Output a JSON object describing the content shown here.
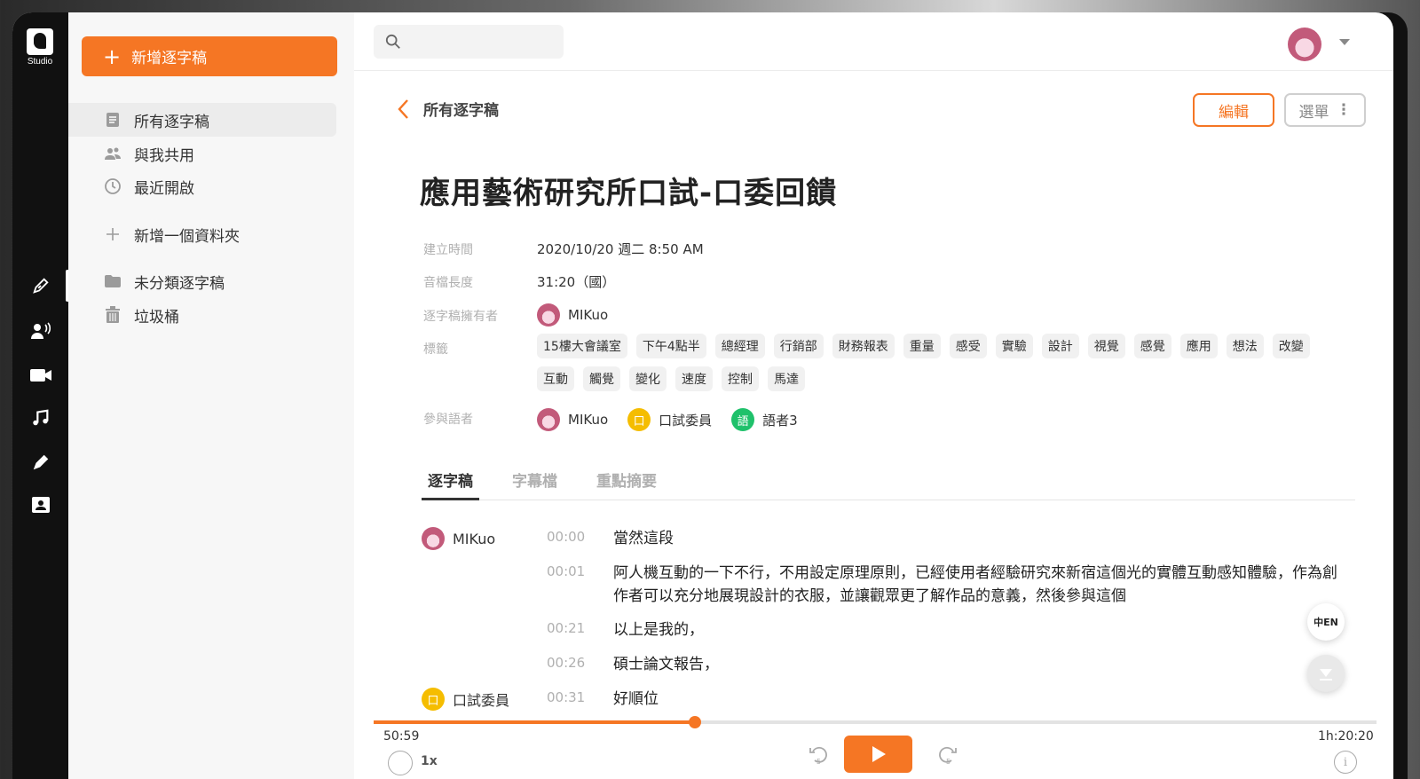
{
  "app": {
    "logo_text": "Studio"
  },
  "sidebar": {
    "new_button": "新增逐字稿",
    "items": [
      {
        "label": "所有逐字稿",
        "icon": "document-icon"
      },
      {
        "label": "與我共用",
        "icon": "people-icon"
      },
      {
        "label": "最近開啟",
        "icon": "clock-icon"
      },
      {
        "label": "新增一個資料夾",
        "icon": "plus-icon"
      },
      {
        "label": "未分類逐字稿",
        "icon": "folder-icon"
      },
      {
        "label": "垃圾桶",
        "icon": "trash-icon"
      }
    ]
  },
  "rail": {
    "items": [
      "pen-icon",
      "speaker-icon",
      "video-icon",
      "music-icon",
      "edit-icon",
      "contact-icon"
    ]
  },
  "search": {
    "placeholder": ""
  },
  "header": {
    "back_label": "所有逐字稿",
    "edit_button": "編輯",
    "menu_button": "選單"
  },
  "transcript": {
    "title": "應用藝術研究所口試-口委回饋",
    "meta": {
      "created_label": "建立時間",
      "created_value": "2020/10/20 週二 8:50 AM",
      "duration_label": "音檔長度",
      "duration_value": "31:20（國）",
      "owner_label": "逐字稿擁有者",
      "owner_value": "MIKuo",
      "tags_label": "標籤",
      "speakers_label": "參與語者"
    },
    "tags": [
      "15樓大會議室",
      "下午4點半",
      "總經理",
      "行銷部",
      "財務報表",
      "重量",
      "感受",
      "實驗",
      "設計",
      "視覺",
      "感覺",
      "應用",
      "想法",
      "改變",
      "互動",
      "觸覺",
      "變化",
      "速度",
      "控制",
      "馬達"
    ],
    "speakers": [
      {
        "name": "MIKuo",
        "badge": "",
        "color": "#c25a7a"
      },
      {
        "name": "口試委員",
        "badge": "口",
        "color": "#f5bd00"
      },
      {
        "name": "語者3",
        "badge": "語",
        "color": "#1fc16b"
      }
    ]
  },
  "tabs": [
    "逐字稿",
    "字幕檔",
    "重點摘要"
  ],
  "lines": [
    {
      "speaker": "MIKuo",
      "time": "00:00",
      "text": "當然這段"
    },
    {
      "speaker": "",
      "time": "00:01",
      "text": "阿人機互動的一下不行，不用設定原理原則，已經使用者經驗研究來新宿這個光的實體互動感知體驗，作為創作者可以充分地展現設計的衣服，並讓觀眾更了解作品的意義，然後參與這個"
    },
    {
      "speaker": "",
      "time": "00:21",
      "text": "以上是我的，"
    },
    {
      "speaker": "",
      "time": "00:26",
      "text": "碩士論文報告，"
    },
    {
      "speaker": "口試委員",
      "time": "00:31",
      "text": "好順位"
    }
  ],
  "float": {
    "translate_label": "中EN"
  },
  "player": {
    "current_time": "50:59",
    "total_time": "1h:20:20",
    "speed": "1x",
    "progress": 0.32,
    "skip_back": "5",
    "skip_forward": "5",
    "accent": "#f57624"
  }
}
